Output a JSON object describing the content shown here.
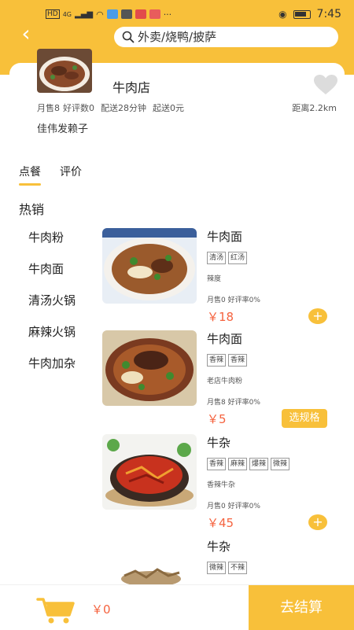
{
  "status_bar": {
    "network": "HD",
    "signal": "4G",
    "time": "7:45"
  },
  "search": {
    "placeholder": "外卖/烧鸭/披萨"
  },
  "shop": {
    "name": "牛肉店",
    "monthly_sales": "月售8",
    "good_reviews": "好评数0",
    "delivery_time": "配送28分钟",
    "min_order": "起送0元",
    "distance": "距离2.2km",
    "description": "佳伟发赖子"
  },
  "tabs": [
    {
      "label": "点餐",
      "active": true
    },
    {
      "label": "评价",
      "active": false
    }
  ],
  "section_title": "热销",
  "categories": [
    "牛肉粉",
    "牛肉面",
    "清汤火锅",
    "麻辣火锅",
    "牛肉加杂"
  ],
  "dishes": [
    {
      "name": "牛肉面",
      "tags": [
        "清汤",
        "红汤"
      ],
      "subtitle": "辣度",
      "stats": "月售0 好评率0%",
      "price": "￥18",
      "action": "add",
      "action_label": "+"
    },
    {
      "name": "牛肉面",
      "tags": [
        "香辣",
        "香辣"
      ],
      "subtitle": "老店牛肉粉",
      "stats": "月售8 好评率0%",
      "price": "￥5",
      "action": "spec",
      "action_label": "选规格"
    },
    {
      "name": "牛杂",
      "tags": [
        "香辣",
        "麻辣",
        "爆辣",
        "微辣"
      ],
      "subtitle": "香辣牛杂",
      "stats": "月售0 好评率0%",
      "price": "￥45",
      "action": "add",
      "action_label": "+"
    },
    {
      "name": "牛杂",
      "tags": [
        "微辣",
        "不辣"
      ]
    }
  ],
  "cart": {
    "total": "￥0",
    "checkout_label": "去结算"
  },
  "colors": {
    "accent": "#f8c03a",
    "price": "#f5633f"
  }
}
